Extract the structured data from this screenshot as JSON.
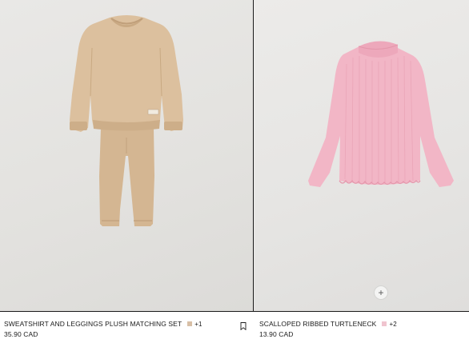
{
  "products": [
    {
      "name": "SWEATSHIRT AND LEGGINGS PLUSH MATCHING SET",
      "swatch_color": "#d8bfa6",
      "more_colors": "+1",
      "price": "35.90 CAD",
      "image_icon": "beige-sweatshirt-and-leggings-image"
    },
    {
      "name": "SCALLOPED RIBBED TURTLENECK",
      "swatch_color": "#f0c4cf",
      "more_colors": "+2",
      "price": "13.90 CAD",
      "image_icon": "pink-turtleneck-image"
    }
  ],
  "quick_add": {
    "symbol": "+"
  },
  "bookmark": {
    "icon": "bookmark-icon"
  }
}
